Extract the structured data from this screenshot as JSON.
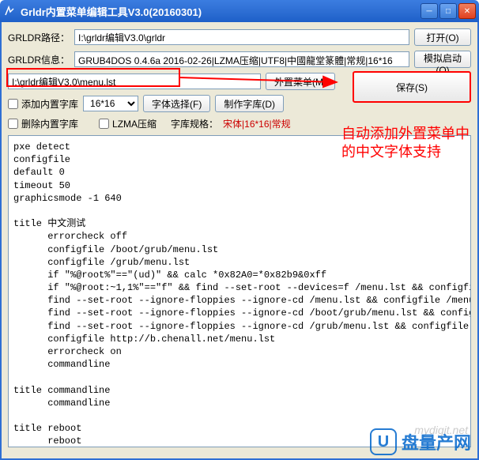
{
  "window": {
    "title": "Grldr内置菜单编辑工具V3.0(20160301)"
  },
  "labels": {
    "path": "GRLDR路径：",
    "info": "GRLDR信息：",
    "fontspec": "字库规格："
  },
  "path_value": "I:\\grldr编辑V3.0\\grldr",
  "info_value": "GRUB4DOS 0.4.6a 2016-02-26|LZMA压缩|UTF8|中國龍堂篆體|常规|16*16",
  "menu_path": "I:\\grldr编辑V3.0\\menu.lst",
  "buttons": {
    "open": "打开(O)",
    "simulate": "模拟启动(Q)",
    "external_menu": "外置菜单(M)",
    "save": "保存(S)",
    "font_select": "字体选择(F)",
    "make_font": "制作字库(D)"
  },
  "checkboxes": {
    "add_builtin": "添加内置字库",
    "delete_builtin": "删除内置字库",
    "lzma": "LZMA压缩"
  },
  "font_size": "16*16",
  "font_spec_value": "宋体|16*16|常规",
  "annotation_line1": "自动添加外置菜单中",
  "annotation_line2": "的中文字体支持",
  "editor_content": "pxe detect\nconfigfile\ndefault 0\ntimeout 50\ngraphicsmode -1 640\n\ntitle 中文测试\n      errorcheck off\n      configfile /boot/grub/menu.lst\n      configfile /grub/menu.lst\n      if \"%@root%\"==\"(ud)\" && calc *0x82A0=*0x82b9&0xff\n      if \"%@root:~1,1%\"==\"f\" && find --set-root --devices=f /menu.lst && configfile /menu.l\n      find --set-root --ignore-floppies --ignore-cd /menu.lst && configfile /menu.lst\n      find --set-root --ignore-floppies --ignore-cd /boot/grub/menu.lst && configfile /boot\n      find --set-root --ignore-floppies --ignore-cd /grub/menu.lst && configfile /grub/menu\n      configfile http://b.chenall.net/menu.lst\n      errorcheck on\n      commandline\n\ntitle commandline\n      commandline\n\ntitle reboot\n      reboot\n\ntitle halt\n      halt\n",
  "watermark": {
    "text": "盘量产网",
    "sub": "mydigit.net"
  }
}
